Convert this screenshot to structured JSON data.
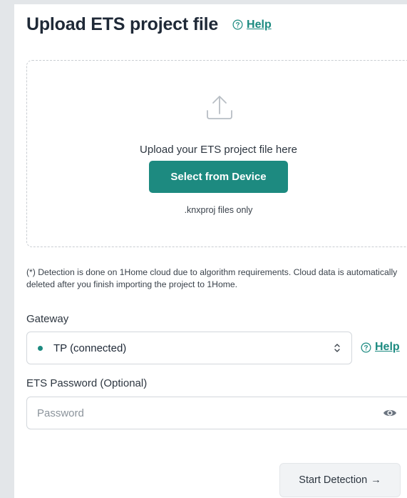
{
  "header": {
    "title": "Upload ETS project file",
    "help_label": "Help"
  },
  "dropzone": {
    "prompt": "Upload your ETS project file here",
    "select_button_label": "Select from Device",
    "file_hint": ".knxproj files only"
  },
  "note": "(*) Detection is done on 1Home cloud due to algorithm requirements. Cloud data is automatically deleted after you finish importing the project to 1Home.",
  "gateway": {
    "label": "Gateway",
    "selected_value": "TP (connected)",
    "status_color": "#1d8a80",
    "help_label": "Help"
  },
  "password": {
    "label": "ETS Password (Optional)",
    "placeholder": "Password"
  },
  "actions": {
    "start_label": "Start Detection",
    "start_arrow": "→"
  },
  "colors": {
    "accent": "#1d8a80",
    "background": "#e3e6e9"
  }
}
